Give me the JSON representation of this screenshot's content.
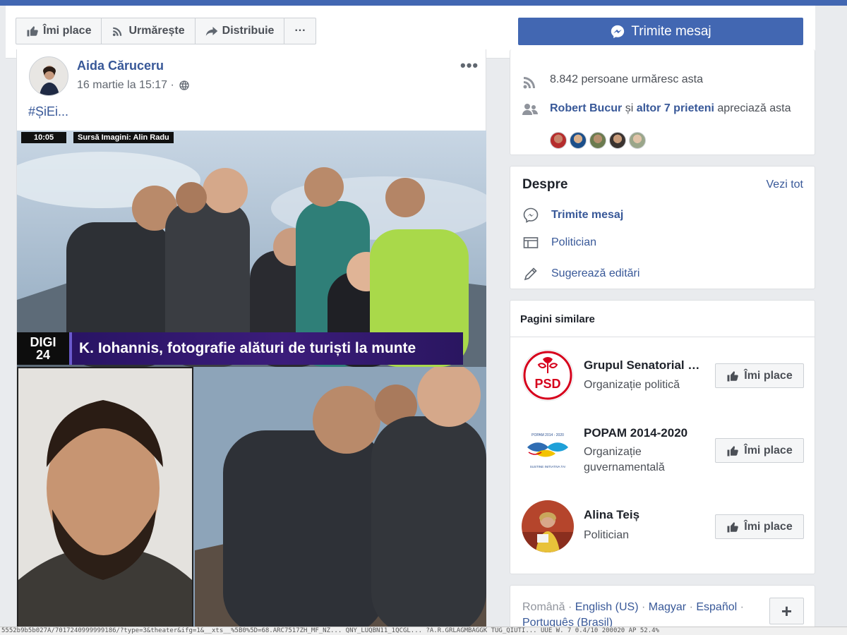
{
  "action_bar": {
    "like_label": "Îmi place",
    "follow_label": "Urmărește",
    "share_label": "Distribuie",
    "more_label": "···",
    "message_label": "Trimite mesaj"
  },
  "post": {
    "author": "Aida Căruceru",
    "date": "16 martie la 15:17 ·",
    "more": "•••",
    "text": "#ȘiEi...",
    "image": {
      "time": "10:05",
      "source": "Sursă Imagini: Alin Radu",
      "logo_top": "DIGI",
      "logo_bottom": "24",
      "caption": "K. Iohannis, fotografie alături de turiști la munte"
    }
  },
  "community": {
    "followers": "8.842 persoane urmăresc asta",
    "friend_name": "Robert Bucur",
    "friends_and": "și",
    "friends_others": "altor 7 prieteni",
    "friends_suffix": "apreciază asta"
  },
  "about": {
    "title": "Despre",
    "see_all": "Vezi tot",
    "send_message": "Trimite mesaj",
    "category": "Politician",
    "suggest_edits": "Sugerează editări"
  },
  "similar": {
    "title": "Pagini similare",
    "like_label": "Îmi place",
    "items": [
      {
        "name": "Grupul Senatorial …",
        "subtitle": "Organizație politică",
        "logo_text": "PSD"
      },
      {
        "name": "POPAM 2014-2020",
        "subtitle": "Organizație guvernamentală",
        "logo_text": "POPAM 2014 - 2020",
        "logo_sub": "SUSTINE INITIATIVA TA!"
      },
      {
        "name": "Alina Teiș",
        "subtitle": "Politician"
      }
    ]
  },
  "languages": {
    "current": "Română",
    "sep": "·",
    "items": [
      "English (US)",
      "Magyar",
      "Español",
      "Português (Brasil)"
    ],
    "plus": "+"
  },
  "status_strip": "5552b9b5b027A/7017240999999186/?type=3&theater&ifg=1&__xts__%5B0%5D=68.ARC7517ZH_MF_NZ... QNY_LUQBN11_1QCGL... ?A.R.GRLAGMBAGGK TUG_QIUTI... UUE W. 7   0.4/10   200020 AP   52.4%",
  "colors": {
    "brand_blue": "#4267b2",
    "link_blue": "#385898",
    "psd_red": "#d6001c",
    "digi_purple": "#3b1c7a"
  }
}
